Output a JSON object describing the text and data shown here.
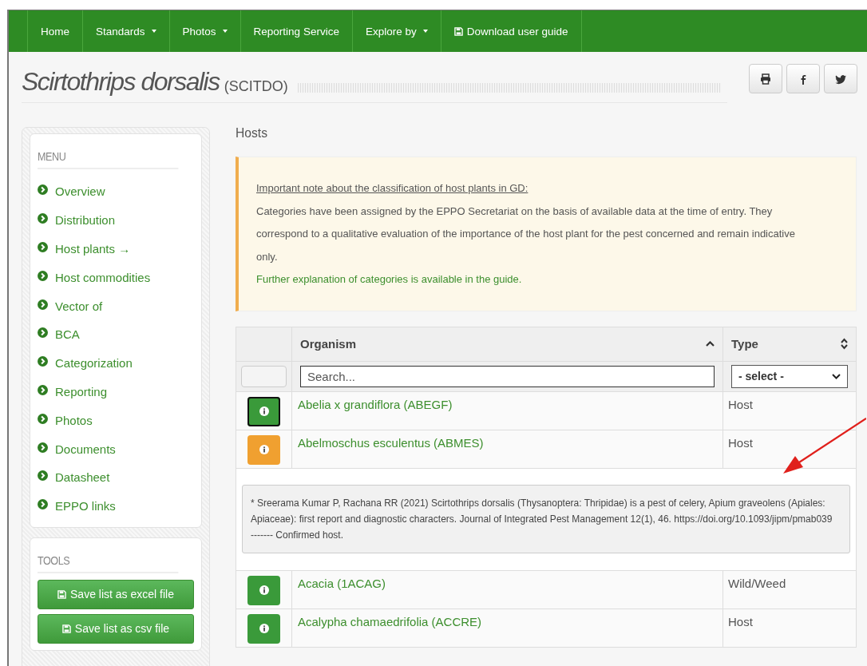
{
  "nav": [
    {
      "label": "Home",
      "kind": "link"
    },
    {
      "label": "Standards",
      "kind": "dropdown"
    },
    {
      "label": "Photos",
      "kind": "dropdown"
    },
    {
      "label": "Reporting Service",
      "kind": "link"
    },
    {
      "label": "Explore by",
      "kind": "dropdown"
    },
    {
      "label": "Download user guide",
      "kind": "download"
    }
  ],
  "title": {
    "name": "Scirtothrips dorsalis",
    "code": "(SCITDO)"
  },
  "share_buttons": [
    {
      "kind": "print"
    },
    {
      "kind": "facebook"
    },
    {
      "kind": "twitter"
    }
  ],
  "sidebar": {
    "menu_title": "MENU",
    "menu": [
      "Overview",
      "Distribution",
      "Host plants →",
      "Host commodities",
      "Vector of",
      "BCA",
      "Categorization",
      "Reporting",
      "Photos",
      "Documents",
      "Datasheet",
      "EPPO links"
    ],
    "tools_title": "TOOLS",
    "tools": [
      "Save list as excel file",
      "Save list as csv file"
    ]
  },
  "section_title": "Hosts",
  "note": {
    "heading": "Important note about the classification of host plants in GD:",
    "body": "Categories have been assigned by the EPPO Secretariat on the basis of available data at the time of entry. They correspond to a qualitative evaluation of the importance of the host plant for the pest concerned and remain indicative only.",
    "link": "Further explanation of categories is available in the guide."
  },
  "table": {
    "columns": [
      {
        "label": "Organism"
      },
      {
        "label": "Type"
      }
    ],
    "search": {
      "placeholder": "Search..."
    },
    "type_filter": {
      "value": "- select -"
    },
    "rows": [
      {
        "organism": "Abelia x grandiflora (ABEGF)",
        "type": "Host",
        "color": "#3a9a3a",
        "focused": true
      },
      {
        "organism": "Abelmoschus esculentus (ABMES)",
        "type": "Host",
        "color": "#f0a030",
        "focused": false,
        "details": [
          "* Sreerama Kumar P, Rachana RR (2021) Scirtothrips dorsalis (Thysanoptera: Thripidae) is a pest of celery, Apium graveolens (Apiales: Apiaceae): first report and diagnostic characters. Journal of Integrated Pest Management 12(1), 46. https://doi.org/10.1093/jipm/pmab039",
          "------- Confirmed host."
        ]
      },
      {
        "organism": "Acacia (1ACAG)",
        "type": "Wild/Weed",
        "color": "#3a9a3a",
        "focused": false
      },
      {
        "organism": "Acalypha chamaedrifolia (ACCRE)",
        "type": "Host",
        "color": "#3a9a3a",
        "focused": false
      }
    ]
  },
  "annotation": {
    "kind": "arrow"
  }
}
